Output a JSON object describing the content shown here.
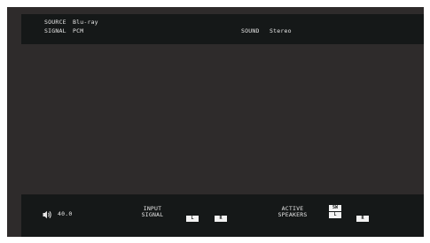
{
  "top": {
    "source_label": "SOURCE",
    "source_value": "Blu-ray",
    "signal_label": "SIGNAL",
    "signal_value": "PCM",
    "sound_label": "SOUND",
    "sound_value": "Stereo"
  },
  "bottom": {
    "volume_icon": "speaker-volume-icon",
    "volume_value": "40.0",
    "input_signal_label_1": "INPUT",
    "input_signal_label_2": "SIGNAL",
    "input_channels": [
      "L",
      "R"
    ],
    "active_speakers_label_1": "ACTIVE",
    "active_speakers_label_2": "SPEAKERS",
    "active_speakers": [
      "SW",
      "L",
      "R"
    ]
  },
  "colors": {
    "screen_bg": "#2e2b2b",
    "bar_bg": "#151818",
    "text": "#e6e6e6",
    "indicator_bg": "#f2f2f2"
  }
}
